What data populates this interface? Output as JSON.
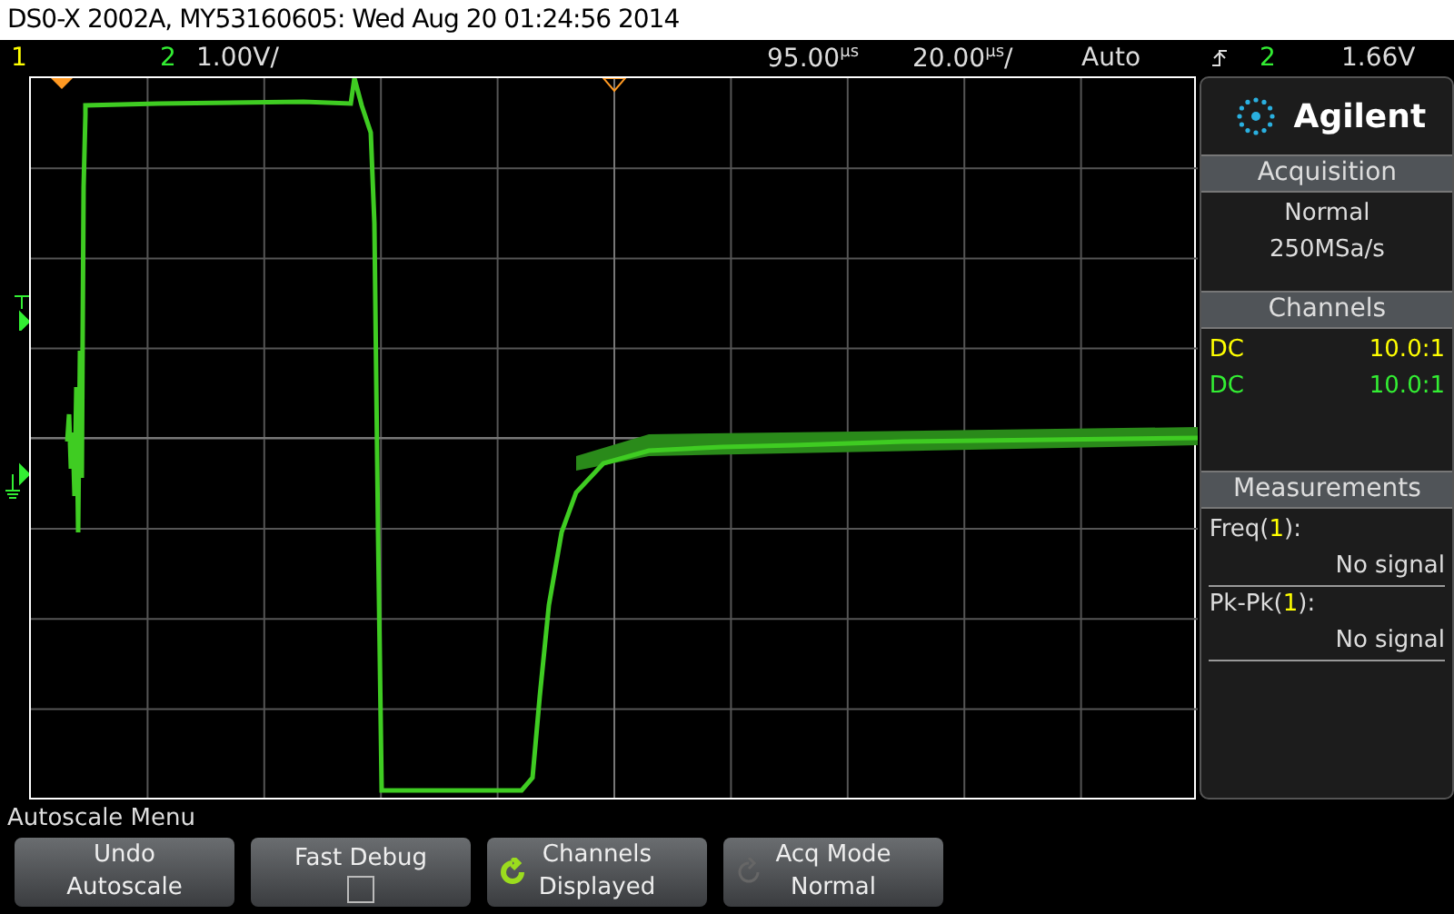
{
  "window": {
    "title": "DS0-X 2002A, MY53160605: Wed Aug 20 01:24:56 2014"
  },
  "status_bar": {
    "channels": [
      {
        "label": "1",
        "color": "#ffff00"
      },
      {
        "label": "2",
        "color": "#33ee33",
        "scale": "1.00V/"
      }
    ],
    "delay": {
      "value": "95.00",
      "unit": "µs"
    },
    "timebase": {
      "value": "20.00",
      "unit": "µs",
      "suffix": "/"
    },
    "trigger_mode": "Auto",
    "trigger_source": "2",
    "trigger_level": "1.66V"
  },
  "side_panel": {
    "logo": "Agilent",
    "acquisition": {
      "title": "Acquisition",
      "lines": [
        "Normal",
        "250MSa/s"
      ]
    },
    "channels": {
      "title": "Channels",
      "rows": [
        {
          "coupling": "DC",
          "probe": "10.0:1",
          "color": "#ffff00"
        },
        {
          "coupling": "DC",
          "probe": "10.0:1",
          "color": "#33ee33"
        }
      ]
    },
    "measurements": {
      "title": "Measurements",
      "items": [
        {
          "name": "Freq(",
          "source": "1",
          "end": "):",
          "value": "No signal"
        },
        {
          "name": "Pk-Pk(",
          "source": "1",
          "end": "):",
          "value": "No signal"
        }
      ]
    }
  },
  "menu": {
    "title": "Autoscale Menu",
    "softkeys": [
      {
        "kind": "text",
        "top": "Undo",
        "bottom": "Autoscale"
      },
      {
        "kind": "checkbox",
        "top": "Fast Debug",
        "checked": false
      },
      {
        "kind": "cycle",
        "top": "Channels",
        "bottom": "Displayed",
        "active": true
      },
      {
        "kind": "cycle",
        "top": "Acq Mode",
        "bottom": "Normal",
        "active": false
      }
    ]
  }
}
